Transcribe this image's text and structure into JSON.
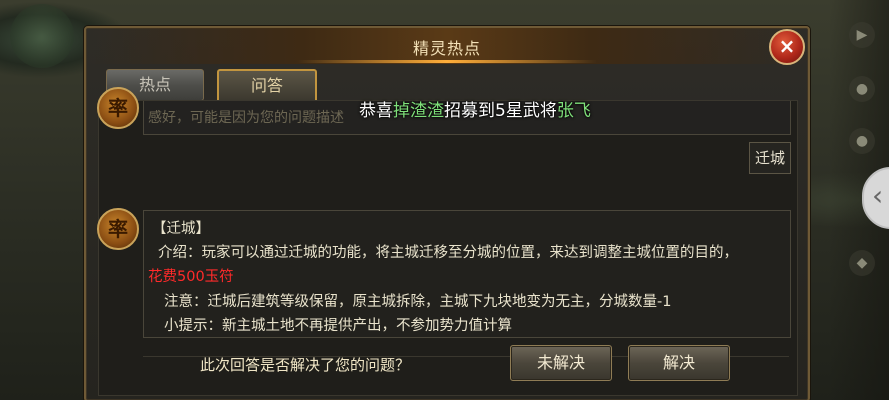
{
  "dialog": {
    "title": "精灵热点",
    "close_icon": "×"
  },
  "tabs": [
    {
      "label": "热点",
      "active": false
    },
    {
      "label": "问答",
      "active": true
    }
  ],
  "broadcast": {
    "prefix": "恭喜",
    "player": "掉渣渣",
    "middle": "招募到5星武将",
    "general": "张飞"
  },
  "faded_text": "感好，可能是因为您的问题描述",
  "avatar_glyph": "率",
  "keyword_button": "迁城",
  "answer": {
    "heading": "【迁城】",
    "intro": "介绍：玩家可以通过迁城的功能，将主城迁移至分城的位置，来达到调整主城位置的目的，",
    "cost": "花费500玉符",
    "note": "注意：迁城后建筑等级保留，原主城拆除，主城下九块地变为无主，分城数量-1",
    "tip": "小提示：新主城土地不再提供产出，不参加势力值计算"
  },
  "footer": {
    "question": "此次回答是否解决了您的问题？",
    "unresolved_label": "未解决",
    "resolved_label": "解决"
  },
  "side_arrow": "‹",
  "colors": {
    "accent_gold": "#c2953f",
    "highlight_green": "#7fe07a",
    "cost_red": "#ff2a2a"
  }
}
